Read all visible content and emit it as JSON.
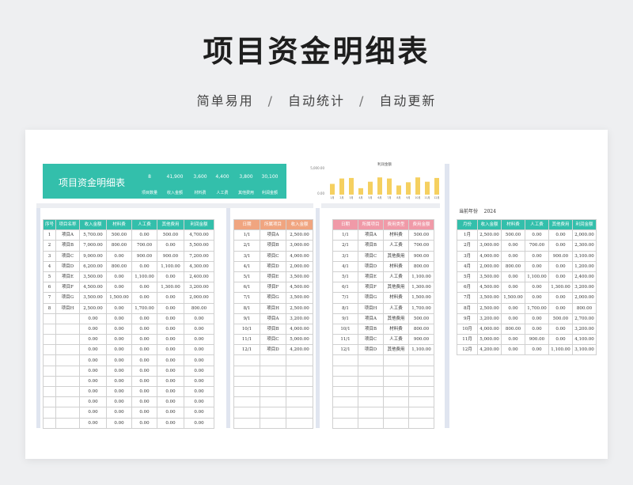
{
  "hero": {
    "title": "项目资金明细表",
    "tags": [
      "简单易用",
      "自动统计",
      "自动更新"
    ],
    "separator": "/"
  },
  "banner": {
    "title": "项目资金明细表",
    "values": [
      "8",
      "41,900",
      "3,600",
      "4,400",
      "3,800",
      "30,100"
    ],
    "labels": [
      "项目数量",
      "收入金额",
      "材料费",
      "人工费",
      "其他费用",
      "利润金额"
    ],
    "color": "#33bfab"
  },
  "chart_data": {
    "type": "bar",
    "title": "利润金额",
    "categories": [
      "1月",
      "2月",
      "3月",
      "4月",
      "5月",
      "6月",
      "7月",
      "8月",
      "9月",
      "10月",
      "11月",
      "12月"
    ],
    "values": [
      2000,
      3000,
      3100,
      1200,
      2400,
      3200,
      3000,
      1700,
      2300,
      3200,
      2400,
      3100
    ],
    "ylim": [
      0,
      5000
    ],
    "y_ticks": [
      "5,000.00",
      "0.00"
    ],
    "bar_color": "#f5d060"
  },
  "project_table": {
    "headers": [
      "序号",
      "项目名称",
      "收入金额",
      "材料费",
      "人工费",
      "其他费用",
      "利润金额"
    ],
    "rows": [
      [
        "1",
        "项目A",
        "5,700.00",
        "500.00",
        "0.00",
        "500.00",
        "4,700.00"
      ],
      [
        "2",
        "项目B",
        "7,000.00",
        "800.00",
        "700.00",
        "0.00",
        "5,500.00"
      ],
      [
        "3",
        "项目C",
        "9,000.00",
        "0.00",
        "900.00",
        "900.00",
        "7,200.00"
      ],
      [
        "4",
        "项目D",
        "6,200.00",
        "800.00",
        "0.00",
        "1,100.00",
        "4,300.00"
      ],
      [
        "5",
        "项目E",
        "3,500.00",
        "0.00",
        "1,100.00",
        "0.00",
        "2,400.00"
      ],
      [
        "6",
        "项目F",
        "4,500.00",
        "0.00",
        "0.00",
        "1,300.00",
        "3,200.00"
      ],
      [
        "7",
        "项目G",
        "3,500.00",
        "1,500.00",
        "0.00",
        "0.00",
        "2,000.00"
      ],
      [
        "8",
        "项目H",
        "2,500.00",
        "0.00",
        "1,700.00",
        "0.00",
        "800.00"
      ],
      [
        "",
        "",
        "0.00",
        "0.00",
        "0.00",
        "0.00",
        "0.00"
      ],
      [
        "",
        "",
        "0.00",
        "0.00",
        "0.00",
        "0.00",
        "0.00"
      ],
      [
        "",
        "",
        "0.00",
        "0.00",
        "0.00",
        "0.00",
        "0.00"
      ],
      [
        "",
        "",
        "0.00",
        "0.00",
        "0.00",
        "0.00",
        "0.00"
      ],
      [
        "",
        "",
        "0.00",
        "0.00",
        "0.00",
        "0.00",
        "0.00"
      ],
      [
        "",
        "",
        "0.00",
        "0.00",
        "0.00",
        "0.00",
        "0.00"
      ],
      [
        "",
        "",
        "0.00",
        "0.00",
        "0.00",
        "0.00",
        "0.00"
      ],
      [
        "",
        "",
        "0.00",
        "0.00",
        "0.00",
        "0.00",
        "0.00"
      ],
      [
        "",
        "",
        "0.00",
        "0.00",
        "0.00",
        "0.00",
        "0.00"
      ],
      [
        "",
        "",
        "0.00",
        "0.00",
        "0.00",
        "0.00",
        "0.00"
      ],
      [
        "",
        "",
        "0.00",
        "0.00",
        "0.00",
        "0.00",
        "0.00"
      ]
    ]
  },
  "income_table": {
    "headers": [
      "日期",
      "所属项目",
      "收入金额"
    ],
    "rows": [
      [
        "1/1",
        "项目A",
        "2,500.00"
      ],
      [
        "2/1",
        "项目B",
        "3,000.00"
      ],
      [
        "3/1",
        "项目C",
        "4,000.00"
      ],
      [
        "4/1",
        "项目D",
        "2,000.00"
      ],
      [
        "5/1",
        "项目E",
        "3,500.00"
      ],
      [
        "6/1",
        "项目F",
        "4,500.00"
      ],
      [
        "7/1",
        "项目G",
        "3,500.00"
      ],
      [
        "8/1",
        "项目H",
        "2,500.00"
      ],
      [
        "9/1",
        "项目A",
        "3,200.00"
      ],
      [
        "10/1",
        "项目B",
        "4,000.00"
      ],
      [
        "11/1",
        "项目C",
        "5,000.00"
      ],
      [
        "12/1",
        "项目D",
        "4,200.00"
      ],
      [
        "",
        "",
        ""
      ],
      [
        "",
        "",
        ""
      ],
      [
        "",
        "",
        ""
      ],
      [
        "",
        "",
        ""
      ],
      [
        "",
        "",
        ""
      ],
      [
        "",
        "",
        ""
      ],
      [
        "",
        "",
        ""
      ]
    ]
  },
  "expense_table": {
    "headers": [
      "日期",
      "所属项目",
      "费用类型",
      "费用金额"
    ],
    "rows": [
      [
        "1/1",
        "项目A",
        "材料费",
        "500.00"
      ],
      [
        "2/1",
        "项目B",
        "人工费",
        "700.00"
      ],
      [
        "3/1",
        "项目C",
        "其他费用",
        "900.00"
      ],
      [
        "4/1",
        "项目D",
        "材料费",
        "800.00"
      ],
      [
        "5/1",
        "项目E",
        "人工费",
        "1,100.00"
      ],
      [
        "6/1",
        "项目F",
        "其他费用",
        "1,300.00"
      ],
      [
        "7/1",
        "项目G",
        "材料费",
        "1,500.00"
      ],
      [
        "8/1",
        "项目H",
        "人工费",
        "1,700.00"
      ],
      [
        "9/1",
        "项目A",
        "其他费用",
        "500.00"
      ],
      [
        "10/1",
        "项目B",
        "材料费",
        "800.00"
      ],
      [
        "11/1",
        "项目C",
        "人工费",
        "900.00"
      ],
      [
        "12/1",
        "项目D",
        "其他费用",
        "1,100.00"
      ],
      [
        "",
        "",
        "",
        ""
      ],
      [
        "",
        "",
        "",
        ""
      ],
      [
        "",
        "",
        "",
        ""
      ],
      [
        "",
        "",
        "",
        ""
      ],
      [
        "",
        "",
        "",
        ""
      ],
      [
        "",
        "",
        "",
        ""
      ],
      [
        "",
        "",
        "",
        ""
      ]
    ]
  },
  "monthly": {
    "year_label": "当前年份",
    "year": "2024",
    "headers": [
      "月份",
      "收入金额",
      "材料费",
      "人工费",
      "其他费用",
      "利润金额"
    ],
    "rows": [
      [
        "1月",
        "2,500.00",
        "500.00",
        "0.00",
        "0.00",
        "2,000.00"
      ],
      [
        "2月",
        "3,000.00",
        "0.00",
        "700.00",
        "0.00",
        "2,300.00"
      ],
      [
        "3月",
        "4,000.00",
        "0.00",
        "0.00",
        "900.00",
        "3,100.00"
      ],
      [
        "4月",
        "2,000.00",
        "800.00",
        "0.00",
        "0.00",
        "1,200.00"
      ],
      [
        "5月",
        "3,500.00",
        "0.00",
        "1,100.00",
        "0.00",
        "2,400.00"
      ],
      [
        "6月",
        "4,500.00",
        "0.00",
        "0.00",
        "1,300.00",
        "3,200.00"
      ],
      [
        "7月",
        "3,500.00",
        "1,500.00",
        "0.00",
        "0.00",
        "2,000.00"
      ],
      [
        "8月",
        "2,500.00",
        "0.00",
        "1,700.00",
        "0.00",
        "800.00"
      ],
      [
        "9月",
        "3,200.00",
        "0.00",
        "0.00",
        "500.00",
        "2,700.00"
      ],
      [
        "10月",
        "4,000.00",
        "800.00",
        "0.00",
        "0.00",
        "3,200.00"
      ],
      [
        "11月",
        "5,000.00",
        "0.00",
        "900.00",
        "0.00",
        "4,100.00"
      ],
      [
        "12月",
        "4,200.00",
        "0.00",
        "0.00",
        "1,100.00",
        "3,100.00"
      ]
    ]
  }
}
